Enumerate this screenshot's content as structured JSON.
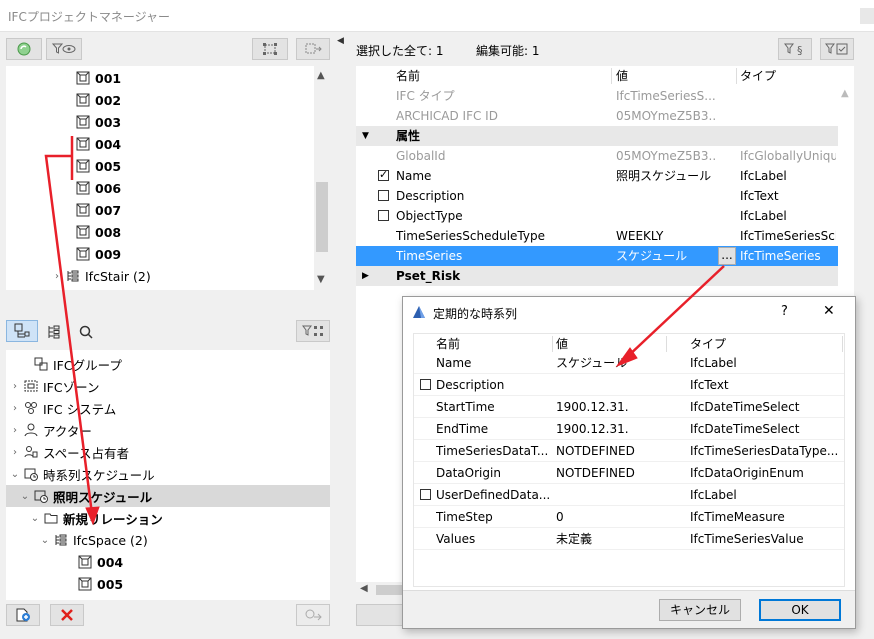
{
  "window": {
    "title": "IFCプロジェクトマネージャー"
  },
  "left_top_tree": {
    "items": [
      {
        "label": "001",
        "bold": true
      },
      {
        "label": "002",
        "bold": true
      },
      {
        "label": "003",
        "bold": true
      },
      {
        "label": "004",
        "bold": true
      },
      {
        "label": "005",
        "bold": true
      },
      {
        "label": "006",
        "bold": true
      },
      {
        "label": "007",
        "bold": true
      },
      {
        "label": "008",
        "bold": true
      },
      {
        "label": "009",
        "bold": true
      },
      {
        "label": "IfcStair (2)",
        "bold": false
      }
    ]
  },
  "left_bottom_tree": {
    "items": [
      {
        "label": "IFCグループ",
        "bold": false
      },
      {
        "label": "IFCゾーン",
        "bold": false
      },
      {
        "label": "IFC システム",
        "bold": false
      },
      {
        "label": "アクター",
        "bold": false
      },
      {
        "label": "スペース占有者",
        "bold": false
      },
      {
        "label": "時系列スケジュール",
        "bold": false
      },
      {
        "label": "照明スケジュール",
        "bold": true
      },
      {
        "label": "新規リレーション",
        "bold": true
      },
      {
        "label": "IfcSpace (2)",
        "bold": false
      },
      {
        "label": "004",
        "bold": true
      },
      {
        "label": "005",
        "bold": true
      }
    ]
  },
  "right_panel": {
    "selected_all": "選択した全て: 1",
    "editable": "編集可能: 1",
    "headers": {
      "name": "名前",
      "value": "値",
      "type": "タイプ"
    },
    "rows": [
      {
        "name": "IFC タイプ",
        "value": "IfcTimeSeriesS...",
        "type": ""
      },
      {
        "name": "ARCHICAD IFC ID",
        "value": "05MOYmeZ5B3...",
        "type": ""
      },
      {
        "name": "属性",
        "value": "",
        "type": ""
      },
      {
        "name": "GlobalId",
        "value": "05MOYmeZ5B3...",
        "type": "IfcGloballyUnique"
      },
      {
        "name": "Name",
        "value": "照明スケジュール",
        "type": "IfcLabel"
      },
      {
        "name": "Description",
        "value": "",
        "type": "IfcText"
      },
      {
        "name": "ObjectType",
        "value": "",
        "type": "IfcLabel"
      },
      {
        "name": "TimeSeriesScheduleType",
        "value": "WEEKLY",
        "type": "IfcTimeSeriesSch"
      },
      {
        "name": "TimeSeries",
        "value": "スケジュール",
        "type": "IfcTimeSeries"
      },
      {
        "name": "Pset_Risk",
        "value": "",
        "type": ""
      }
    ],
    "ellipsis": "..."
  },
  "dialog": {
    "title": "定期的な時系列",
    "help": "?",
    "close": "✕",
    "headers": {
      "name": "名前",
      "value": "値",
      "type": "タイプ"
    },
    "rows": [
      {
        "name": "Name",
        "value": "スケジュール",
        "type": "IfcLabel"
      },
      {
        "name": "Description",
        "value": "",
        "type": "IfcText"
      },
      {
        "name": "StartTime",
        "value": "1900.12.31.",
        "type": "IfcDateTimeSelect"
      },
      {
        "name": "EndTime",
        "value": "1900.12.31.",
        "type": "IfcDateTimeSelect"
      },
      {
        "name": "TimeSeriesDataT...",
        "value": "NOTDEFINED",
        "type": "IfcTimeSeriesDataType..."
      },
      {
        "name": "DataOrigin",
        "value": "NOTDEFINED",
        "type": "IfcDataOriginEnum"
      },
      {
        "name": "UserDefinedData...",
        "value": "",
        "type": "IfcLabel"
      },
      {
        "name": "TimeStep",
        "value": "0",
        "type": "IfcTimeMeasure"
      },
      {
        "name": "Values",
        "value": "未定義",
        "type": "IfcTimeSeriesValue"
      }
    ],
    "cancel_label": "キャンセル",
    "ok_label": "OK"
  },
  "colors": {
    "selection": "#3399ff",
    "annotation": "#e8202a",
    "group_bg": "#e8e8e8"
  }
}
